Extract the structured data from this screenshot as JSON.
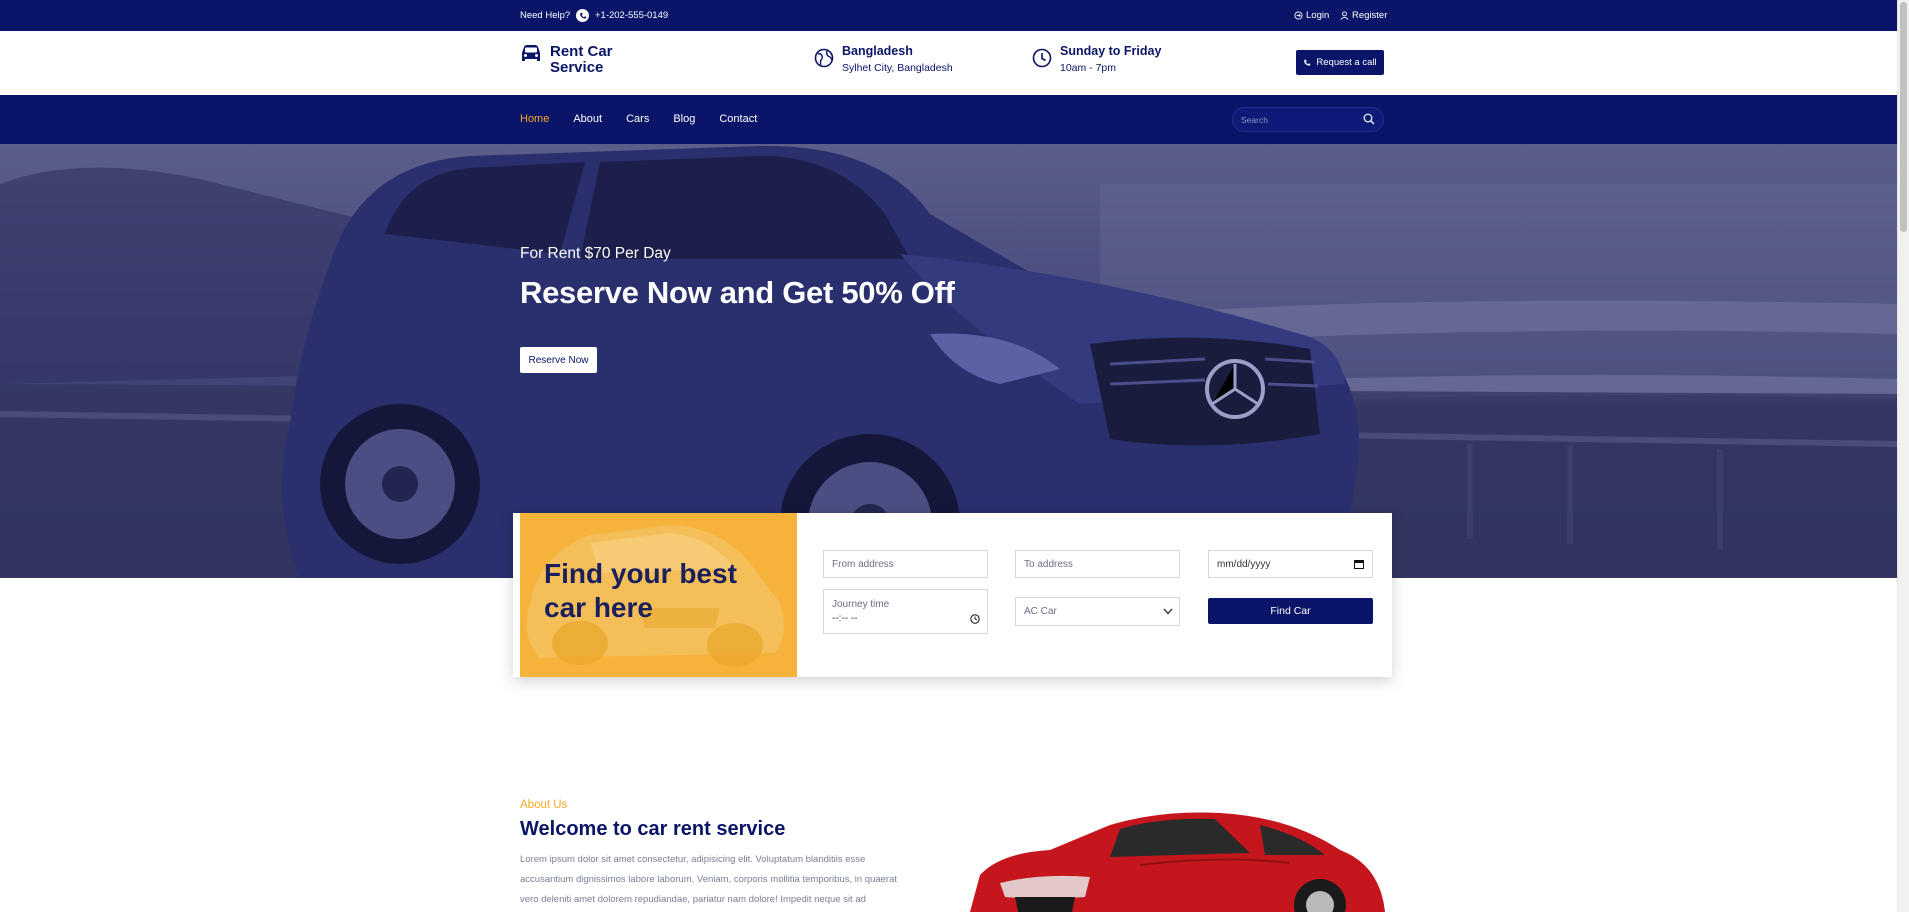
{
  "topbar": {
    "help_label": "Need Help?",
    "phone": "+1-202-555-0149",
    "login_label": "Login",
    "register_label": "Register"
  },
  "header": {
    "brand_name": "Rent Car Service",
    "location_title": "Bangladesh",
    "location_sub": "Sylhet City, Bangladesh",
    "hours_title": "Sunday to Friday",
    "hours_sub": "10am - 7pm",
    "call_button": "Request a call"
  },
  "nav": {
    "items": [
      {
        "label": "Home",
        "active": true
      },
      {
        "label": "About",
        "active": false
      },
      {
        "label": "Cars",
        "active": false
      },
      {
        "label": "Blog",
        "active": false
      },
      {
        "label": "Contact",
        "active": false
      }
    ],
    "search_placeholder": "Search"
  },
  "hero": {
    "subtitle": "For Rent $70 Per Day",
    "title": "Reserve Now and Get 50% Off",
    "button": "Reserve Now"
  },
  "finder": {
    "title": "Find your best car here",
    "from_placeholder": "From address",
    "to_placeholder": "To address",
    "date_value": "mm/dd/yyyy",
    "journey_label": "Journey time",
    "journey_value": "--:-- --",
    "car_type": "AC Car",
    "find_button": "Find Car"
  },
  "about": {
    "eyebrow": "About Us",
    "title": "Welcome to car rent service",
    "text": "Lorem ipsum dolor sit amet consectetur, adipisicing elit. Voluptatum blanditiis esse accusantium dignissimos labore laborum. Veniam, corporis mollitia temporibus, in quaerat vero deleniti amet dolorem repudiandae, pariatur nam dolore! Impedit neque sit ad temporibus quam similique dolor ipsam"
  },
  "colors": {
    "primary": "#0a1569",
    "accent": "#f7a824",
    "finder_panel": "#f6b23a"
  }
}
